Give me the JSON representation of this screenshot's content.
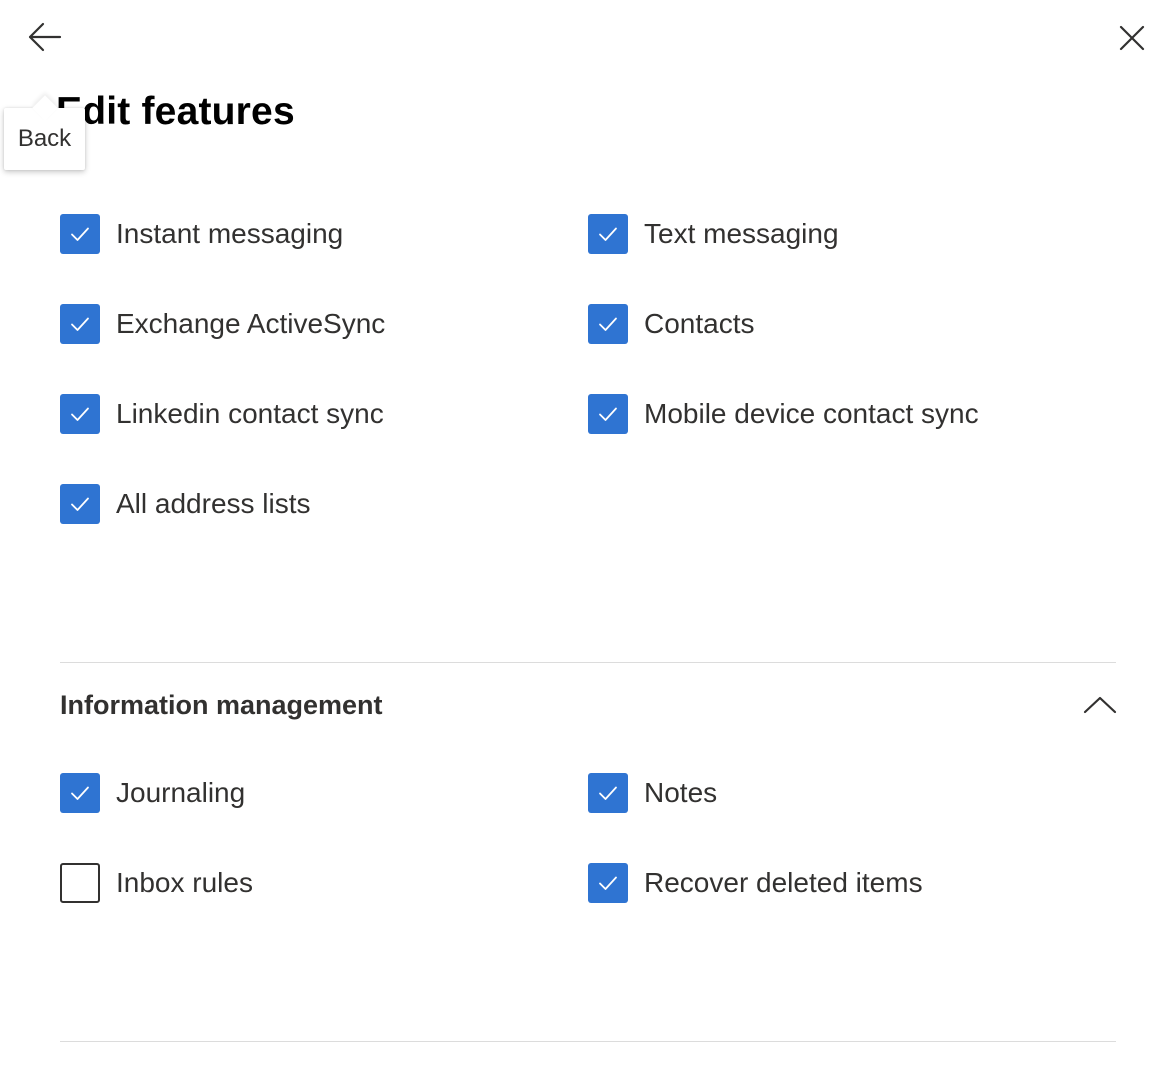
{
  "header": {
    "back_tooltip": "Back",
    "icons": {
      "back": "arrow-left-icon",
      "close": "close-icon"
    }
  },
  "panel": {
    "title": "Edit features"
  },
  "features": [
    {
      "label": "Instant messaging",
      "checked": true
    },
    {
      "label": "Text messaging",
      "checked": true
    },
    {
      "label": "Exchange ActiveSync",
      "checked": true
    },
    {
      "label": "Contacts",
      "checked": true
    },
    {
      "label": "Linkedin contact sync",
      "checked": true
    },
    {
      "label": "Mobile device contact sync",
      "checked": true
    },
    {
      "label": "All address lists",
      "checked": true
    }
  ],
  "information_management": {
    "heading": "Information management",
    "icon": "chevron-up-icon",
    "items": [
      {
        "label": "Journaling",
        "checked": true
      },
      {
        "label": "Notes",
        "checked": true
      },
      {
        "label": "Inbox rules",
        "checked": false
      },
      {
        "label": "Recover deleted items",
        "checked": true
      }
    ]
  },
  "colors": {
    "checkbox_accent": "#2f74d2",
    "text": "#323130",
    "divider": "#dcdcdc"
  }
}
